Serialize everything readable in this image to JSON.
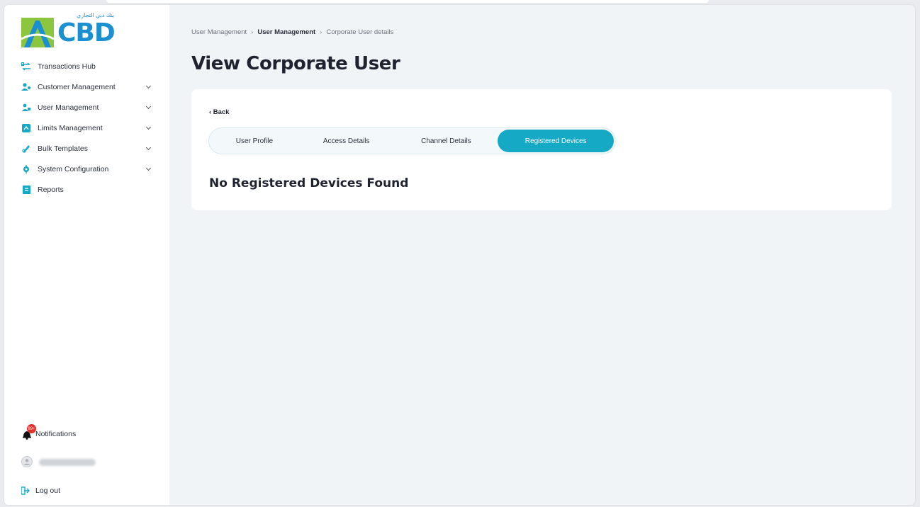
{
  "brand": {
    "logo_text": "CBD",
    "logo_arabic": "بنك دبي التجاري",
    "primary_color": "#1a8fd1",
    "accent_color": "#15a9c6",
    "logo_green": "#8cc63f"
  },
  "sidebar": {
    "items": [
      {
        "label": "Transactions Hub",
        "icon": "transfer-icon",
        "has_chevron": false
      },
      {
        "label": "Customer Management",
        "icon": "users-icon",
        "has_chevron": true
      },
      {
        "label": "User Management",
        "icon": "user-icon",
        "has_chevron": true
      },
      {
        "label": "Limits Management",
        "icon": "limits-icon",
        "has_chevron": true
      },
      {
        "label": "Bulk Templates",
        "icon": "template-icon",
        "has_chevron": true
      },
      {
        "label": "System Configuration",
        "icon": "config-icon",
        "has_chevron": true
      },
      {
        "label": "Reports",
        "icon": "report-icon",
        "has_chevron": false
      }
    ],
    "notifications": {
      "label": "Notifications",
      "badge": "99+"
    },
    "logout": {
      "label": "Log out"
    }
  },
  "breadcrumb": {
    "items": [
      "User Management",
      "User Management",
      "Corporate User details"
    ]
  },
  "page": {
    "title": "View Corporate User",
    "back_label": "‹ Back",
    "tabs": [
      {
        "label": "User Profile",
        "active": false
      },
      {
        "label": "Access Details",
        "active": false
      },
      {
        "label": "Channel Details",
        "active": false
      },
      {
        "label": "Registered Devices",
        "active": true
      }
    ],
    "empty_message": "No Registered Devices Found"
  }
}
